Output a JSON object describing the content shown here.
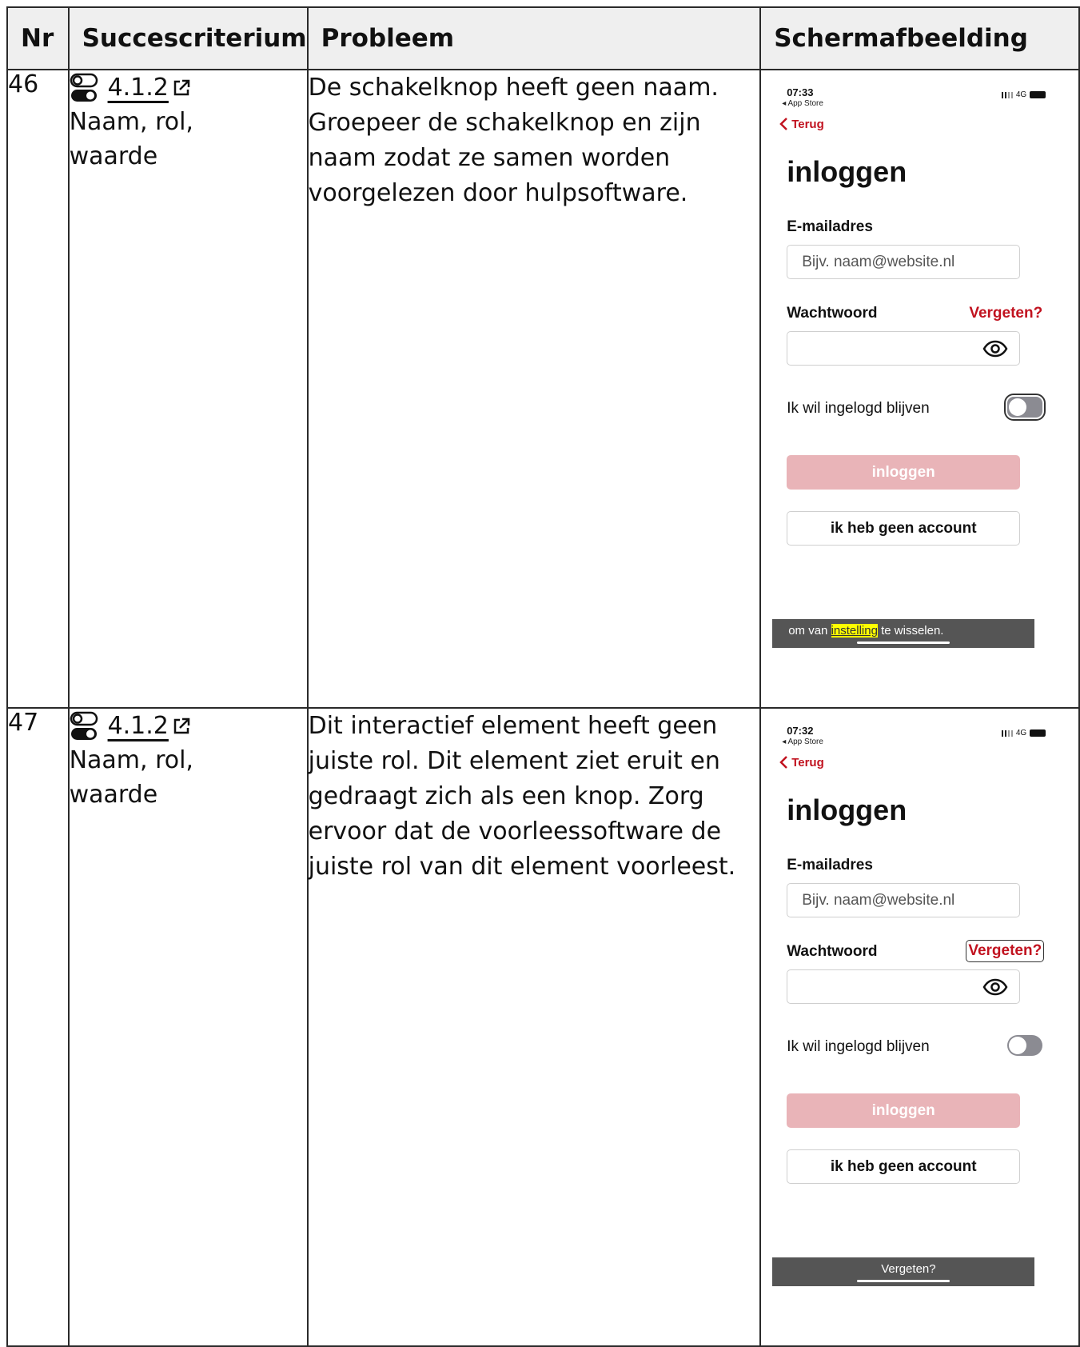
{
  "headers": {
    "nr": "Nr",
    "succescriterium": "Succescriterium",
    "probleem": "Probleem",
    "schermafbeelding": "Schermafbeelding"
  },
  "rows": [
    {
      "nr": "46",
      "criterion_code": "4.1.2",
      "criterion_name": "Naam, rol, waarde",
      "problem": "De schakelknop heeft geen naam. Groepeer de schakelknop en zijn naam zodat ze samen worden voorgelezen door hulpsoftware.",
      "screenshot": {
        "time": "07:33",
        "status_sub": "◂ App Store",
        "network": "4G",
        "back": "Terug",
        "title": "inloggen",
        "email_label": "E-mailadres",
        "email_placeholder": "Bijv. naam@website.nl",
        "password_label": "Wachtwoord",
        "forgot": "Vergeten?",
        "stay_logged_in": "Ik wil ingelogd blijven",
        "login_button": "inloggen",
        "no_account_button": "ik heb geen account",
        "caption_before": "om van ",
        "caption_highlight": "instelling",
        "caption_after": " te wisselen."
      }
    },
    {
      "nr": "47",
      "criterion_code": "4.1.2",
      "criterion_name": "Naam, rol, waarde",
      "problem": "Dit interactief element heeft geen juiste rol. Dit element ziet eruit en gedraagt zich als een knop. Zorg ervoor dat de voorleessoftware de juiste rol van dit element voorleest.",
      "screenshot": {
        "time": "07:32",
        "status_sub": "◂ App Store",
        "network": "4G",
        "back": "Terug",
        "title": "inloggen",
        "email_label": "E-mailadres",
        "email_placeholder": "Bijv. naam@website.nl",
        "password_label": "Wachtwoord",
        "forgot": "Vergeten?",
        "stay_logged_in": "Ik wil ingelogd blijven",
        "login_button": "inloggen",
        "no_account_button": "ik heb geen account",
        "caption": "Vergeten?"
      }
    }
  ]
}
